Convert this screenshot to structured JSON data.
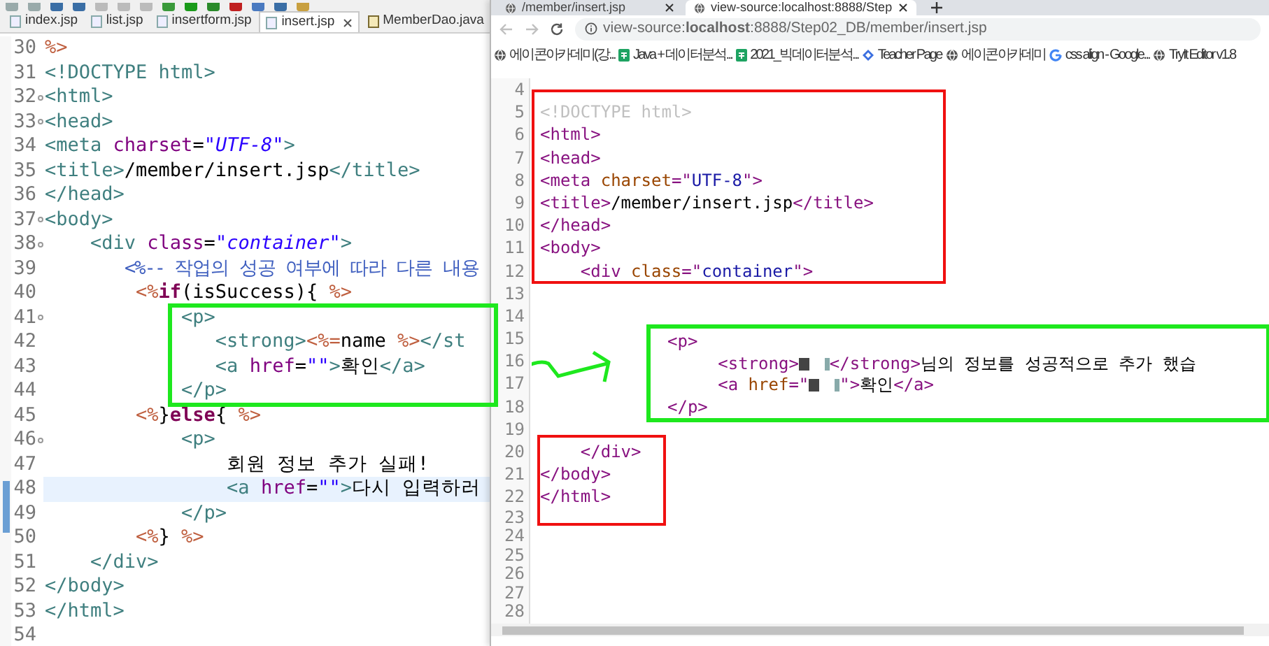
{
  "editor": {
    "tabs": [
      {
        "label": "index.jsp",
        "kind": "jsp",
        "selected": false
      },
      {
        "label": "list.jsp",
        "kind": "jsp",
        "selected": false
      },
      {
        "label": "insertform.jsp",
        "kind": "jsp",
        "selected": false
      },
      {
        "label": "insert.jsp",
        "kind": "jsp",
        "selected": true
      },
      {
        "label": "MemberDao.java",
        "kind": "java",
        "selected": false
      }
    ],
    "lines": [
      {
        "number": "30",
        "fold": false,
        "highlighted": false,
        "segments": [
          {
            "text": "%>",
            "kind": "jsp"
          }
        ]
      },
      {
        "number": "31",
        "fold": false,
        "highlighted": false,
        "segments": [
          {
            "text": "<!DOCTYPE html>",
            "kind": "tag"
          }
        ]
      },
      {
        "number": "32",
        "fold": true,
        "highlighted": false,
        "segments": [
          {
            "text": "<html>",
            "kind": "tag"
          }
        ]
      },
      {
        "number": "33",
        "fold": true,
        "highlighted": false,
        "segments": [
          {
            "text": "<head>",
            "kind": "tag"
          }
        ]
      },
      {
        "number": "34",
        "fold": false,
        "highlighted": false,
        "segments": [
          {
            "text": "<meta ",
            "kind": "tag"
          },
          {
            "text": "charset",
            "kind": "attr"
          },
          {
            "text": "=",
            "kind": "text"
          },
          {
            "text": "\"UTF-8\"",
            "kind": "value"
          },
          {
            "text": ">",
            "kind": "tag"
          }
        ]
      },
      {
        "number": "35",
        "fold": false,
        "highlighted": false,
        "segments": [
          {
            "text": "<title>",
            "kind": "tag"
          },
          {
            "text": "/member/insert.jsp",
            "kind": "text"
          },
          {
            "text": "</title>",
            "kind": "tag"
          }
        ]
      },
      {
        "number": "36",
        "fold": false,
        "highlighted": false,
        "segments": [
          {
            "text": "</head>",
            "kind": "tag"
          }
        ]
      },
      {
        "number": "37",
        "fold": true,
        "highlighted": false,
        "segments": [
          {
            "text": "<body>",
            "kind": "tag"
          }
        ]
      },
      {
        "number": "38",
        "fold": true,
        "highlighted": false,
        "segments": [
          {
            "text": "    <div ",
            "kind": "tag"
          },
          {
            "text": "class",
            "kind": "attr"
          },
          {
            "text": "=",
            "kind": "text"
          },
          {
            "text": "\"container\"",
            "kind": "value"
          },
          {
            "text": ">",
            "kind": "tag"
          }
        ]
      },
      {
        "number": "39",
        "fold": false,
        "highlighted": false,
        "segments": [
          {
            "text": "        <%-- 작업의 성공 여부에 따라 다른 내용",
            "kind": "comment"
          }
        ]
      },
      {
        "number": "40",
        "fold": false,
        "highlighted": false,
        "segments": [
          {
            "text": "        <%",
            "kind": "jsp"
          },
          {
            "text": "if",
            "kind": "keyword"
          },
          {
            "text": "(isSuccess){ ",
            "kind": "text"
          },
          {
            "text": "%>",
            "kind": "jsp"
          }
        ]
      },
      {
        "number": "41",
        "fold": true,
        "highlighted": false,
        "segments": [
          {
            "text": "            <p>",
            "kind": "tag"
          }
        ]
      },
      {
        "number": "42",
        "fold": false,
        "highlighted": false,
        "segments": [
          {
            "text": "               <strong>",
            "kind": "tag"
          },
          {
            "text": "<%=",
            "kind": "jsp"
          },
          {
            "text": "name ",
            "kind": "text"
          },
          {
            "text": "%>",
            "kind": "jsp"
          },
          {
            "text": "</st",
            "kind": "tag"
          }
        ]
      },
      {
        "number": "43",
        "fold": false,
        "highlighted": false,
        "segments": [
          {
            "text": "               <a ",
            "kind": "tag"
          },
          {
            "text": "href",
            "kind": "attr"
          },
          {
            "text": "=",
            "kind": "text"
          },
          {
            "text": "\"\"",
            "kind": "value"
          },
          {
            "text": ">",
            "kind": "tag"
          },
          {
            "text": "확인",
            "kind": "text"
          },
          {
            "text": "</a>",
            "kind": "tag"
          }
        ]
      },
      {
        "number": "44",
        "fold": false,
        "highlighted": false,
        "segments": [
          {
            "text": "            </p>",
            "kind": "tag"
          }
        ]
      },
      {
        "number": "45",
        "fold": false,
        "highlighted": false,
        "segments": [
          {
            "text": "        <%",
            "kind": "jsp"
          },
          {
            "text": "}",
            "kind": "text"
          },
          {
            "text": "else",
            "kind": "keyword"
          },
          {
            "text": "{ ",
            "kind": "text"
          },
          {
            "text": "%>",
            "kind": "jsp"
          }
        ]
      },
      {
        "number": "46",
        "fold": true,
        "highlighted": false,
        "segments": [
          {
            "text": "            <p>",
            "kind": "tag"
          }
        ]
      },
      {
        "number": "47",
        "fold": false,
        "highlighted": false,
        "segments": [
          {
            "text": "                회원 정보 추가 실패!",
            "kind": "text"
          }
        ]
      },
      {
        "number": "48",
        "fold": false,
        "highlighted": true,
        "segments": [
          {
            "text": "                <a ",
            "kind": "tag"
          },
          {
            "text": "href",
            "kind": "attr"
          },
          {
            "text": "=",
            "kind": "text"
          },
          {
            "text": "\"\"",
            "kind": "value"
          },
          {
            "text": ">",
            "kind": "tag"
          },
          {
            "text": "다시 입력하러",
            "kind": "text"
          }
        ]
      },
      {
        "number": "49",
        "fold": false,
        "highlighted": false,
        "segments": [
          {
            "text": "            </p>",
            "kind": "tag"
          }
        ]
      },
      {
        "number": "50",
        "fold": false,
        "highlighted": false,
        "segments": [
          {
            "text": "        <%",
            "kind": "jsp"
          },
          {
            "text": "} ",
            "kind": "text"
          },
          {
            "text": "%>",
            "kind": "jsp"
          }
        ]
      },
      {
        "number": "51",
        "fold": false,
        "highlighted": false,
        "segments": [
          {
            "text": "    </div>",
            "kind": "tag"
          }
        ]
      },
      {
        "number": "52",
        "fold": false,
        "highlighted": false,
        "segments": [
          {
            "text": "</body>",
            "kind": "tag"
          }
        ]
      },
      {
        "number": "53",
        "fold": false,
        "highlighted": false,
        "segments": [
          {
            "text": "</html>",
            "kind": "tag"
          }
        ]
      },
      {
        "number": "54",
        "fold": false,
        "highlighted": false
      }
    ]
  },
  "browser": {
    "tabs": [
      {
        "title": "/member/insert.jsp",
        "selected": false
      },
      {
        "title": "view-source:localhost:8888/Step",
        "selected": true
      }
    ],
    "address": "view-source:**localhost**:8888/Step02_DB/member/insert.jsp",
    "bookmarks": [
      {
        "label": "에이콘아카데미(강...",
        "kind": "site"
      },
      {
        "label": "Java + 데이터분석...",
        "kind": "sheet"
      },
      {
        "label": "2021_빅데이터분석...",
        "kind": "sheet"
      },
      {
        "label": "Teacher Page",
        "kind": "teacher"
      },
      {
        "label": "에이콘아카데미",
        "kind": "site"
      },
      {
        "label": "css align - Google...",
        "kind": "search"
      },
      {
        "label": "TryIt Editor v1.8",
        "kind": "site"
      }
    ],
    "source_lines": [
      {
        "number": "4"
      },
      {
        "number": "5",
        "segments": [
          {
            "text": "<!DOCTYPE html>",
            "kind": "doctype"
          }
        ]
      },
      {
        "number": "6",
        "segments": [
          {
            "text": "<html>",
            "kind": "tag"
          }
        ]
      },
      {
        "number": "7",
        "segments": [
          {
            "text": "<head>",
            "kind": "tag"
          }
        ]
      },
      {
        "number": "8",
        "segments": [
          {
            "text": "<meta ",
            "kind": "tag"
          },
          {
            "text": "charset",
            "kind": "attr"
          },
          {
            "text": "=\"",
            "kind": "tag"
          },
          {
            "text": "UTF-8",
            "kind": "value"
          },
          {
            "text": "\">",
            "kind": "tag"
          }
        ]
      },
      {
        "number": "9",
        "segments": [
          {
            "text": "<title>",
            "kind": "tag"
          },
          {
            "text": "/member/insert.jsp",
            "kind": "text"
          },
          {
            "text": "</title>",
            "kind": "tag"
          }
        ]
      },
      {
        "number": "10",
        "segments": [
          {
            "text": "</head>",
            "kind": "tag"
          }
        ]
      },
      {
        "number": "11",
        "segments": [
          {
            "text": "<body>",
            "kind": "tag"
          }
        ]
      },
      {
        "number": "12",
        "segments": [
          {
            "text": "    <div ",
            "kind": "tag"
          },
          {
            "text": "class",
            "kind": "attr"
          },
          {
            "text": "=\"",
            "kind": "tag"
          },
          {
            "text": "container",
            "kind": "value"
          },
          {
            "text": "\">",
            "kind": "tag"
          }
        ]
      },
      {
        "number": "13"
      },
      {
        "number": "14"
      },
      {
        "number": "15"
      },
      {
        "number": "16"
      },
      {
        "number": "17"
      },
      {
        "number": "18"
      },
      {
        "number": "19"
      },
      {
        "number": "20",
        "segments": [
          {
            "text": "    </div>",
            "kind": "tag"
          }
        ]
      },
      {
        "number": "21",
        "segments": [
          {
            "text": "</body>",
            "kind": "tag"
          }
        ]
      },
      {
        "number": "22",
        "segments": [
          {
            "text": "</html>",
            "kind": "tag"
          }
        ]
      },
      {
        "number": "23"
      },
      {
        "number": "24"
      },
      {
        "number": "25"
      },
      {
        "number": "26"
      },
      {
        "number": "27"
      },
      {
        "number": "28"
      }
    ]
  },
  "pasted_snippet": {
    "lines": [
      {
        "segments": [
          {
            "text": "<p>",
            "kind": "tag"
          }
        ]
      },
      {
        "segments": [
          {
            "text": "     <strong>",
            "kind": "tag"
          },
          {
            "kind": "redacted"
          },
          {
            "text": "</strong>",
            "kind": "tag"
          },
          {
            "text": "님의 정보를 성공적으로 추가 했습",
            "kind": "text"
          }
        ]
      },
      {
        "segments": [
          {
            "text": "     <a ",
            "kind": "tag"
          },
          {
            "text": "href",
            "kind": "attr"
          },
          {
            "text": "=\"",
            "kind": "tag"
          },
          {
            "kind": "redacted"
          },
          {
            "text": "\">",
            "kind": "tag"
          },
          {
            "text": "확인",
            "kind": "text"
          },
          {
            "text": "</a>",
            "kind": "tag"
          }
        ]
      },
      {
        "segments": [
          {
            "text": "</p>",
            "kind": "tag"
          }
        ]
      }
    ]
  }
}
